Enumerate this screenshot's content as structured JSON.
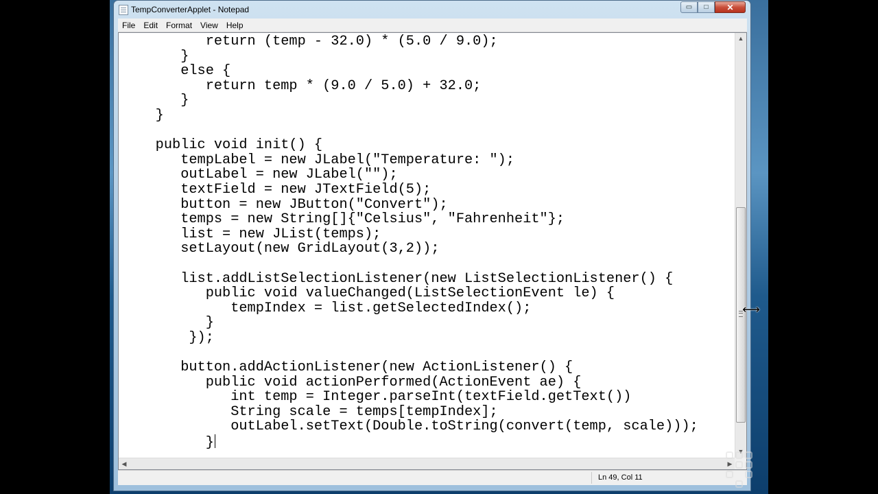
{
  "window": {
    "title": "TempConverterApplet - Notepad",
    "minimize_glyph": "▭",
    "maximize_glyph": "□",
    "close_glyph": "✕",
    "app_icon": "notepad-icon"
  },
  "menubar": {
    "items": [
      {
        "label": "File"
      },
      {
        "label": "Edit"
      },
      {
        "label": "Format"
      },
      {
        "label": "View"
      },
      {
        "label": "Help"
      }
    ]
  },
  "editor": {
    "lines": [
      "          return (temp - 32.0) * (5.0 / 9.0);",
      "       }",
      "       else {",
      "          return temp * (9.0 / 5.0) + 32.0;",
      "       }",
      "    }",
      "",
      "    public void init() {",
      "       tempLabel = new JLabel(\"Temperature: \");",
      "       outLabel = new JLabel(\"\");",
      "       textField = new JTextField(5);",
      "       button = new JButton(\"Convert\");",
      "       temps = new String[]{\"Celsius\", \"Fahrenheit\"};",
      "       list = new JList(temps);",
      "       setLayout(new GridLayout(3,2));",
      "",
      "       list.addListSelectionListener(new ListSelectionListener() {",
      "          public void valueChanged(ListSelectionEvent le) {",
      "             tempIndex = list.getSelectedIndex();",
      "          }",
      "        });",
      "",
      "       button.addActionListener(new ActionListener() {",
      "          public void actionPerformed(ActionEvent ae) {",
      "             int temp = Integer.parseInt(textField.getText())",
      "             String scale = temps[tempIndex];",
      "             outLabel.setText(Double.toString(convert(temp, scale)));",
      "          }"
    ]
  },
  "scrollbars": {
    "up_arrow": "▲",
    "down_arrow": "▼",
    "left_arrow": "◀",
    "right_arrow": "▶"
  },
  "statusbar": {
    "position": "Ln 49, Col 11"
  },
  "colors": {
    "editor_bg": "#ffffff",
    "text": "#000000",
    "window_frame": "#b6d0e6"
  },
  "cursor": {
    "icon": "resize-horizontal-cursor-icon",
    "glyph": "⟷"
  }
}
